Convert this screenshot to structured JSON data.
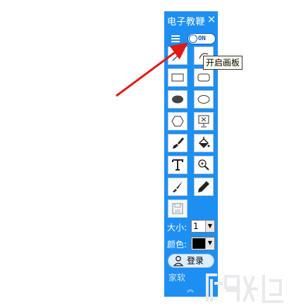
{
  "window": {
    "title": "电子教鞭",
    "close_symbol": "×"
  },
  "toggle": {
    "label": "ON",
    "state": "on"
  },
  "tooltip": "开启画板",
  "tools": [
    {
      "name": "line-tool-icon"
    },
    {
      "name": "curve-tool-icon"
    },
    {
      "name": "rectangle-tool-icon"
    },
    {
      "name": "rounded-rectangle-tool-icon"
    },
    {
      "name": "filled-ellipse-tool-icon"
    },
    {
      "name": "ellipse-tool-icon"
    },
    {
      "name": "hexagon-tool-icon"
    },
    {
      "name": "screen-clear-tool-icon"
    },
    {
      "name": "brush-tool-icon"
    },
    {
      "name": "fill-bucket-tool-icon"
    },
    {
      "name": "text-tool-icon"
    },
    {
      "name": "zoom-tool-icon"
    },
    {
      "name": "paintbrush-tool-icon"
    },
    {
      "name": "pencil-tool-icon"
    },
    {
      "name": "save-tool-icon"
    }
  ],
  "size": {
    "label": "大小:",
    "value": "1"
  },
  "color": {
    "label": "颜色:",
    "value": "#000000"
  },
  "login": {
    "label": "登录"
  },
  "footer": {
    "text": "家软"
  },
  "colors": {
    "panel": "#1d8ff2",
    "arrow": "#e01818"
  }
}
